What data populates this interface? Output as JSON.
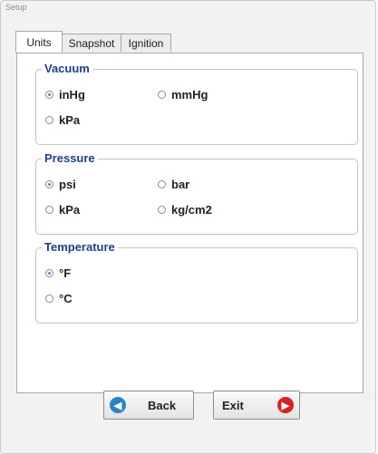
{
  "window": {
    "title": "Setup"
  },
  "tabs": [
    {
      "label": "Units",
      "active": true
    },
    {
      "label": "Snapshot",
      "active": false
    },
    {
      "label": "Ignition",
      "active": false
    }
  ],
  "groups": {
    "vacuum": {
      "label": "Vacuum",
      "options": [
        {
          "label": "inHg",
          "selected": true
        },
        {
          "label": "mmHg",
          "selected": false
        },
        {
          "label": "kPa",
          "selected": false
        }
      ]
    },
    "pressure": {
      "label": "Pressure",
      "options": [
        {
          "label": "psi",
          "selected": true
        },
        {
          "label": "bar",
          "selected": false
        },
        {
          "label": "kPa",
          "selected": false
        },
        {
          "label": "kg/cm2",
          "selected": false
        }
      ]
    },
    "temperature": {
      "label": "Temperature",
      "options": [
        {
          "label": "°F",
          "selected": true
        },
        {
          "label": "°C",
          "selected": false
        }
      ]
    }
  },
  "buttons": {
    "back": {
      "label": "Back",
      "icon": "arrow-left-icon",
      "color": "#2a82c8"
    },
    "exit": {
      "label": "Exit",
      "icon": "arrow-right-icon",
      "color": "#d92121"
    }
  },
  "colors": {
    "accent": "#1f3f8f",
    "radio_dot": "#3f8fd0"
  }
}
